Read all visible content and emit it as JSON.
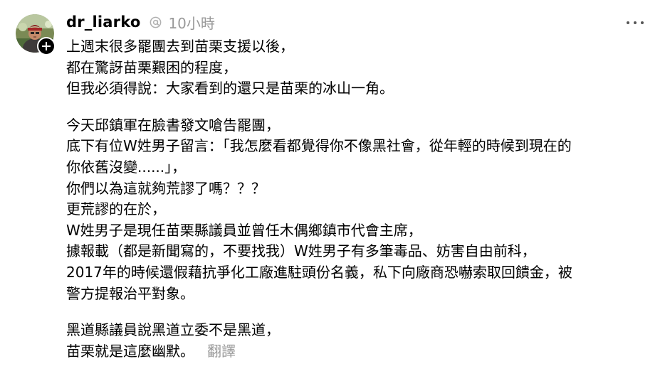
{
  "post": {
    "username": "dr_liarko",
    "time": "10小時",
    "paragraphs": [
      [
        "上週末很多罷團去到苗栗支援以後，",
        "都在驚訝苗栗艱困的程度，",
        "但我必須得說：大家看到的還只是苗栗的冰山一角。"
      ],
      [
        "今天邱鎮軍在臉書發文嗆告罷團，",
        "底下有位W姓男子留言：「我怎麼看都覺得你不像黑社會，從年輕的時候到現在的",
        "你依舊沒變......」，",
        "你們以為這就夠荒謬了嗎？？？",
        "更荒謬的在於，",
        "W姓男子是現任苗栗縣議員並曾任木偶鄉鎮市代會主席，",
        "據報載（都是新聞寫的，不要找我）W姓男子有多筆毒品、妨害自由前科，",
        "2017年的時候還假藉抗爭化工廠進駐頭份名義，私下向廠商恐嚇索取回饋金，被",
        "警方提報治平對象。"
      ],
      [
        "黑道縣議員說黑道立委不是黑道，",
        "苗栗就是這麼幽默。"
      ]
    ],
    "translate_label": "翻譯"
  },
  "icons": {
    "avatar": "avatar",
    "follow": "plus-icon",
    "meta": "threads-at-icon",
    "more": "more-horizontal-icon"
  },
  "colors": {
    "text": "#000000",
    "secondary": "#999999",
    "background": "#ffffff"
  }
}
